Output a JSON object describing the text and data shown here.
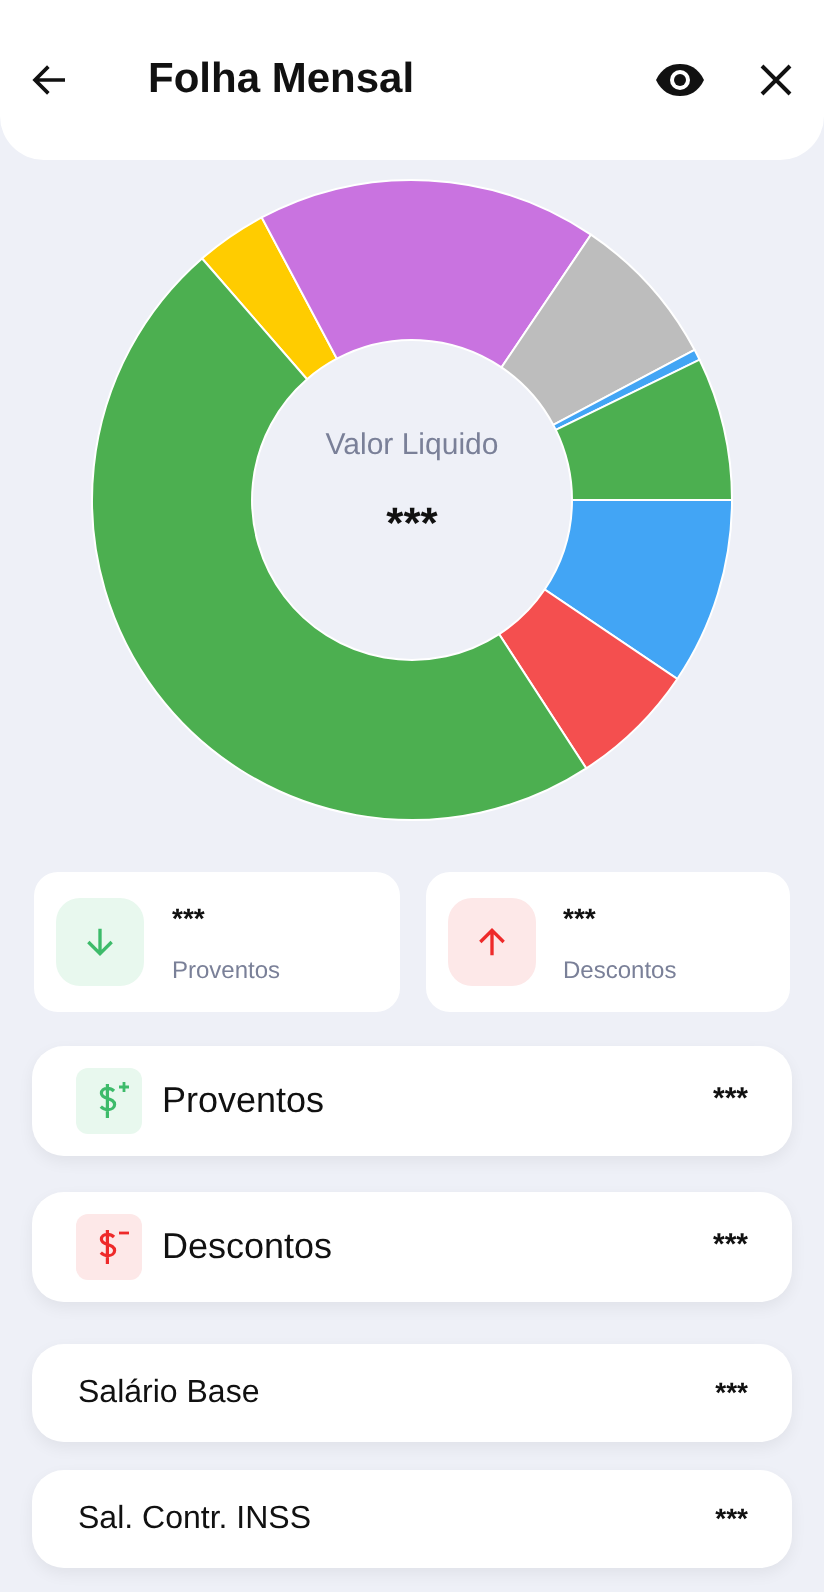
{
  "header": {
    "title": "Folha Mensal"
  },
  "chart_center": {
    "label": "Valor Liquido",
    "value": "***"
  },
  "summary": [
    {
      "kind": "income",
      "value": "***",
      "label": "Proventos"
    },
    {
      "kind": "deduction",
      "value": "***",
      "label": "Descontos"
    }
  ],
  "sections": [
    {
      "kind": "income",
      "label": "Proventos",
      "value": "***"
    },
    {
      "kind": "deduction",
      "label": "Descontos",
      "value": "***"
    }
  ],
  "items": [
    {
      "label": "Salário Base",
      "value": "***"
    },
    {
      "label": "Sal. Contr. INSS",
      "value": "***"
    }
  ]
}
